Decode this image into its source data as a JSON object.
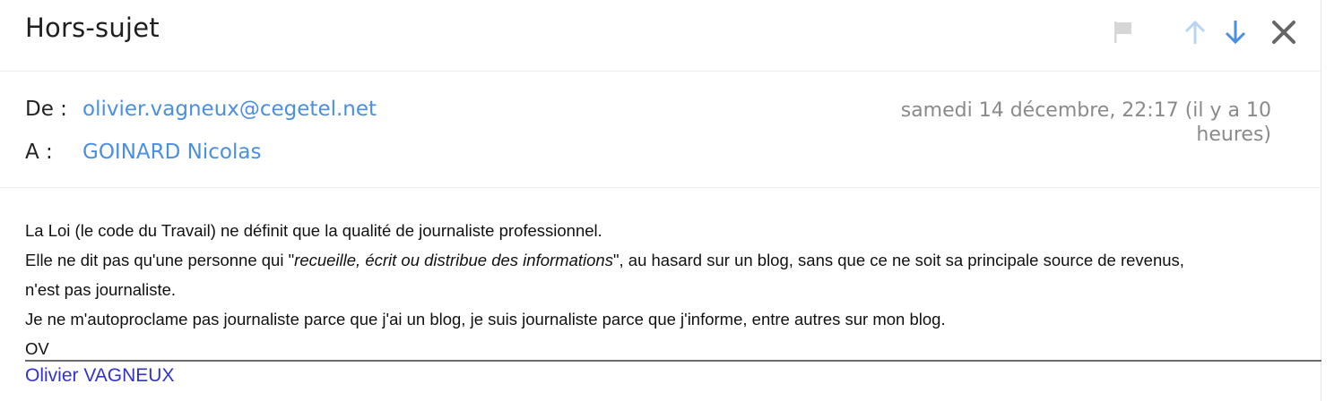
{
  "header": {
    "subject": "Hors-sujet",
    "icons": [
      "flag-icon",
      "arrow-up-icon",
      "arrow-down-icon",
      "close-icon"
    ]
  },
  "meta": {
    "from_label": "De :",
    "from_value": "olivier.vagneux@cegetel.net",
    "to_label": "A :",
    "to_value": "GOINARD Nicolas",
    "date_line1": "samedi 14 décembre, 22:17 (il y a 10",
    "date_line2": "heures)"
  },
  "body": {
    "line1": "La Loi (le code du Travail) ne définit que la qualité de journaliste professionnel.",
    "line2_before": "Elle ne dit pas qu'une personne qui \"",
    "line2_italic": "recueille, écrit ou distribue des informations",
    "line2_after": "\", au hasard sur un blog, sans que ce ne soit sa principale source de revenus,",
    "line3": "n'est pas journaliste.",
    "line4": "Je ne m'autoproclame pas journaliste parce que j'ai un blog, je suis journaliste parce que j'informe, entre autres sur mon blog.",
    "line5": "OV",
    "signature": "Olivier VAGNEUX"
  },
  "colors": {
    "link": "#4a8fe0",
    "signature": "#3333cc",
    "icon_disabled": "#b8d4f3",
    "icon_active": "#4a8fe0",
    "flag": "#d6d6d6",
    "close": "#666666"
  }
}
